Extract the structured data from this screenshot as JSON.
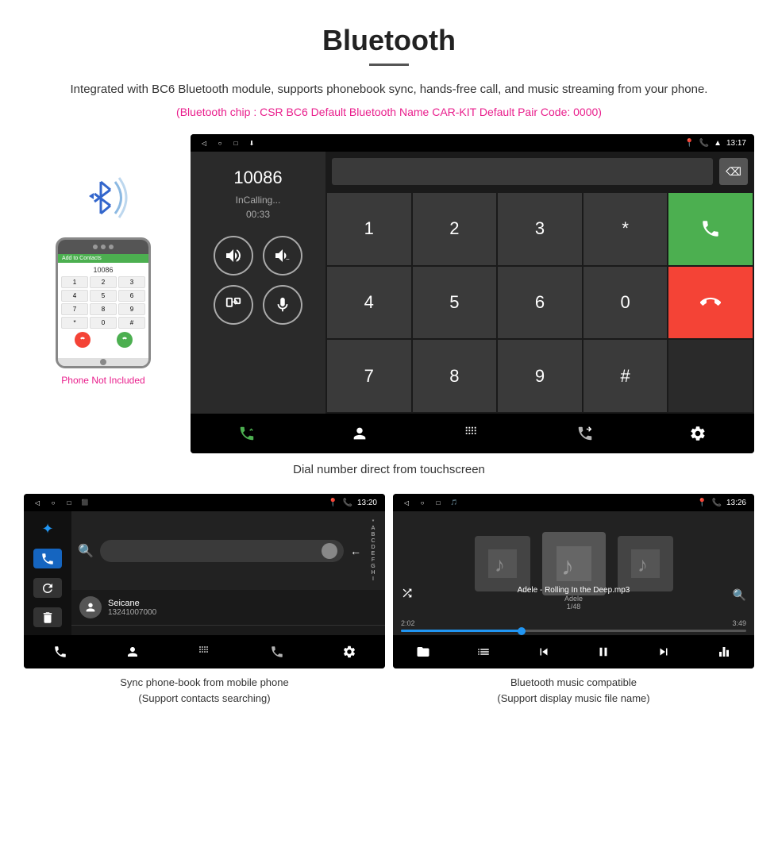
{
  "page": {
    "title": "Bluetooth",
    "description": "Integrated with BC6 Bluetooth module, supports phonebook sync, hands-free call, and music streaming from your phone.",
    "specs": "(Bluetooth chip : CSR BC6    Default Bluetooth Name CAR-KIT    Default Pair Code: 0000)"
  },
  "top_screen": {
    "status_bar": {
      "time": "13:17",
      "icons_left": [
        "back",
        "home",
        "square",
        "download"
      ]
    },
    "dialer": {
      "number": "10086",
      "status": "InCalling...",
      "timer": "00:33",
      "keys": [
        "1",
        "2",
        "3",
        "*",
        "4",
        "5",
        "6",
        "0",
        "7",
        "8",
        "9",
        "#"
      ]
    }
  },
  "phone_side": {
    "not_included": "Phone Not Included"
  },
  "captions": {
    "top": "Dial number direct from touchscreen",
    "bottom_left": "Sync phone-book from mobile phone\n(Support contacts searching)",
    "bottom_right": "Bluetooth music compatible\n(Support display music file name)"
  },
  "bottom_left_screen": {
    "status_time": "13:20",
    "contact_name": "Seicane",
    "contact_number": "13241007000",
    "alpha": [
      "*",
      "A",
      "B",
      "C",
      "D",
      "E",
      "F",
      "G",
      "H",
      "I"
    ]
  },
  "bottom_right_screen": {
    "status_time": "13:26",
    "song": "Adele - Rolling In the Deep.mp3",
    "artist": "Adele",
    "track": "1/48",
    "time_current": "2:02",
    "time_total": "3:49"
  }
}
